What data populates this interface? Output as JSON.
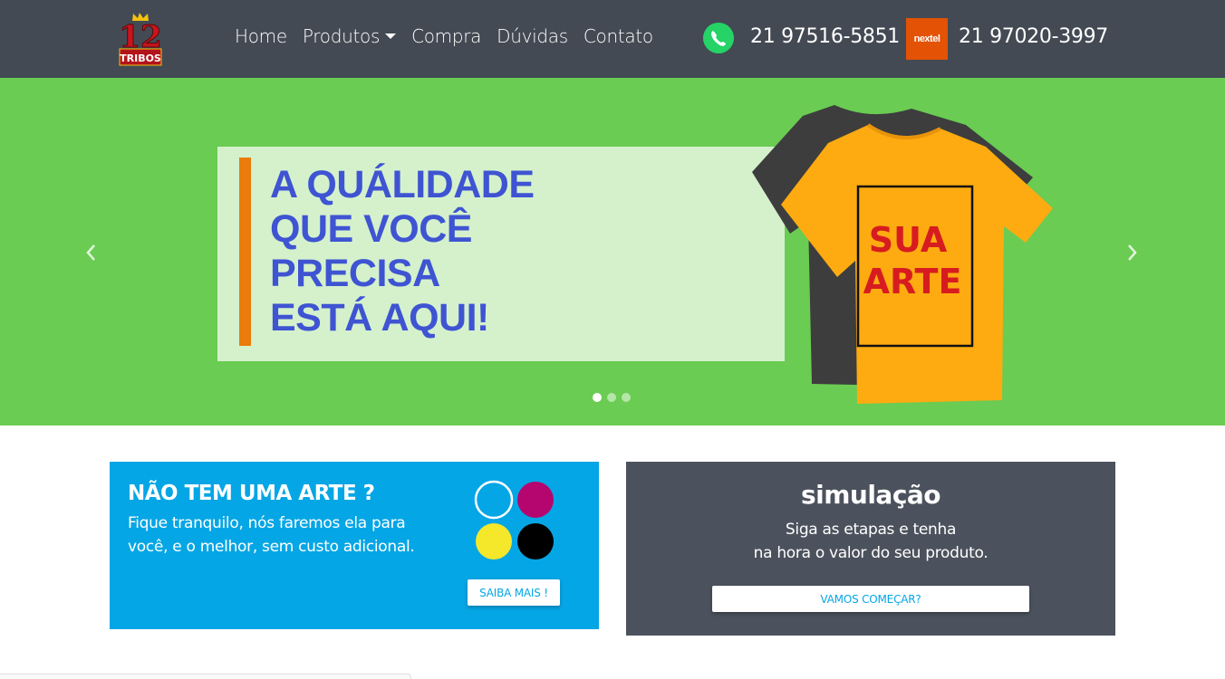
{
  "brand": {
    "logo_number": "12",
    "logo_word": "TRIBOS"
  },
  "nav": {
    "home": "Home",
    "produtos": "Produtos",
    "compra": "Compra",
    "duvidas": "Dúvidas",
    "contato": "Contato"
  },
  "contacts": {
    "whatsapp_phone": "21 97516-5851",
    "nextel_label": "nextel",
    "nextel_phone": "21 97020-3997"
  },
  "hero": {
    "line1": "A QUÁLIDADE",
    "line2": "QUE VOCÊ",
    "line3": "PRECISA",
    "line4": "ESTÁ AQUI!",
    "shirt_line1": "SUA",
    "shirt_line2": "ARTE",
    "slide_count": 3,
    "active_slide": 1
  },
  "card_art": {
    "title": "NÃO TEM UMA ARTE ?",
    "text": "Fique tranquilo, nós faremos ela para você, e o melhor, sem custo adicional.",
    "button": "SAIBA MAIS !"
  },
  "card_sim": {
    "title": "simulação",
    "line1": "Siga as etapas e tenha",
    "line2": "na hora o valor do seu produto.",
    "button": "VAMOS COMEÇAR?"
  },
  "colors": {
    "navbar": "#434a54",
    "hero_bg": "#6acc52",
    "hero_text": "#3f54d2",
    "accent_orange": "#ea7c0b",
    "card_blue": "#05a6e5",
    "card_dark": "#4c525d",
    "shirt_yellow": "#fdab11",
    "shirt_text": "#d71c20"
  }
}
